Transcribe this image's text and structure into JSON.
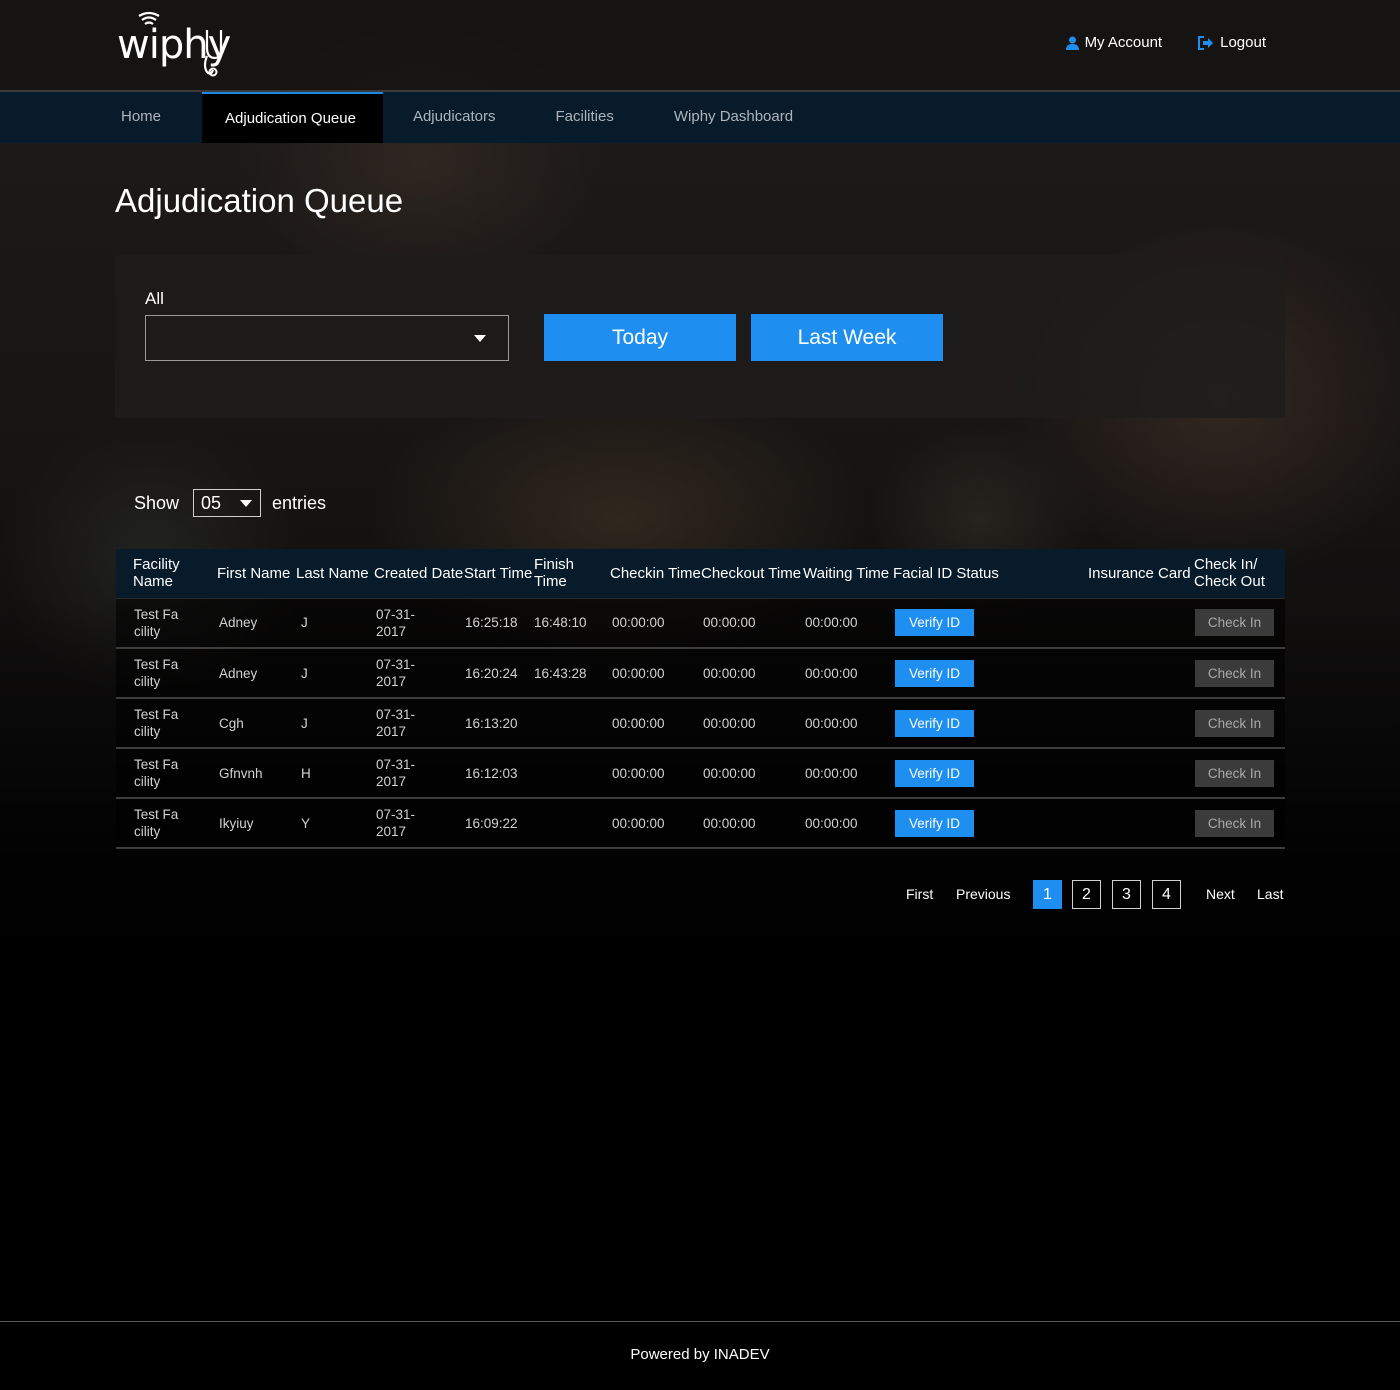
{
  "brand": {
    "logo_text": "wiphy",
    "accent_color": "#1e8ff0",
    "nav_bg_color": "#081b2b"
  },
  "header": {
    "links": [
      {
        "label": "My Account",
        "icon": "user-icon"
      },
      {
        "label": "Logout",
        "icon": "logout-icon"
      }
    ]
  },
  "nav": {
    "items": [
      {
        "label": "Home",
        "active": false
      },
      {
        "label": "Adjudication Queue",
        "active": true
      },
      {
        "label": "Adjudicators",
        "active": false
      },
      {
        "label": "Facilities",
        "active": false
      },
      {
        "label": "Wiphy Dashboard",
        "active": false
      }
    ]
  },
  "page": {
    "title": "Adjudication Queue"
  },
  "filter": {
    "label": "All",
    "select_value": "",
    "today_label": "Today",
    "last_week_label": "Last Week"
  },
  "entries": {
    "show_label": "Show",
    "value": "05",
    "entries_label": "entries"
  },
  "table": {
    "columns": [
      "Facility Name",
      "First Name",
      "Last Name",
      "Created Date",
      "Start Time",
      "Finish Time",
      "Checkin Time",
      "Checkout Time",
      "Waiting Time",
      "Facial ID Status",
      "Insurance Card",
      "Check In/ Check Out"
    ],
    "rows": [
      {
        "facility": "Test Facility",
        "first": "Adney",
        "last": "J",
        "created": "07-31-2017",
        "start": "16:25:18",
        "finish": "16:48:10",
        "checkin": "00:00:00",
        "checkout": "00:00:00",
        "waiting": "00:00:00",
        "facial": "Verify ID",
        "insurance": "",
        "action": "Check In"
      },
      {
        "facility": "Test Facility",
        "first": "Adney",
        "last": "J",
        "created": "07-31-2017",
        "start": "16:20:24",
        "finish": "16:43:28",
        "checkin": "00:00:00",
        "checkout": "00:00:00",
        "waiting": "00:00:00",
        "facial": "Verify ID",
        "insurance": "",
        "action": "Check In"
      },
      {
        "facility": "Test Facility",
        "first": "Cgh",
        "last": "J",
        "created": "07-31-2017",
        "start": "16:13:20",
        "finish": "",
        "checkin": "00:00:00",
        "checkout": "00:00:00",
        "waiting": "00:00:00",
        "facial": "Verify ID",
        "insurance": "",
        "action": "Check In"
      },
      {
        "facility": "Test Facility",
        "first": "Gfnvnh",
        "last": "H",
        "created": "07-31-2017",
        "start": "16:12:03",
        "finish": "",
        "checkin": "00:00:00",
        "checkout": "00:00:00",
        "waiting": "00:00:00",
        "facial": "Verify ID",
        "insurance": "",
        "action": "Check In"
      },
      {
        "facility": "Test Facility",
        "first": "Ikyiuy",
        "last": "Y",
        "created": "07-31-2017",
        "start": "16:09:22",
        "finish": "",
        "checkin": "00:00:00",
        "checkout": "00:00:00",
        "waiting": "00:00:00",
        "facial": "Verify ID",
        "insurance": "",
        "action": "Check In"
      }
    ]
  },
  "pagination": {
    "first": "First",
    "previous": "Previous",
    "pages": [
      "1",
      "2",
      "3",
      "4"
    ],
    "current": "1",
    "next": "Next",
    "last": "Last"
  },
  "footer": {
    "text": "Powered by INADEV"
  }
}
